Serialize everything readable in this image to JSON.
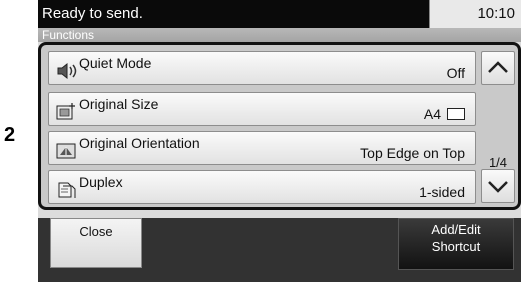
{
  "callout": "2",
  "status": {
    "message": "Ready to send.",
    "time": "10:10"
  },
  "section": {
    "title": "Functions"
  },
  "functions": {
    "items": [
      {
        "label": "Quiet Mode",
        "value": "Off",
        "icon": "quiet-mode-icon"
      },
      {
        "label": "Original Size",
        "value": "A4",
        "icon": "original-size-icon"
      },
      {
        "label": "Original Orientation",
        "value": "Top Edge on Top",
        "icon": "original-orientation-icon"
      },
      {
        "label": "Duplex",
        "value": "1-sided",
        "icon": "duplex-icon"
      }
    ],
    "page_indicator": "1/4"
  },
  "footer": {
    "close_label": "Close",
    "shortcut_line1": "Add/Edit",
    "shortcut_line2": "Shortcut"
  }
}
